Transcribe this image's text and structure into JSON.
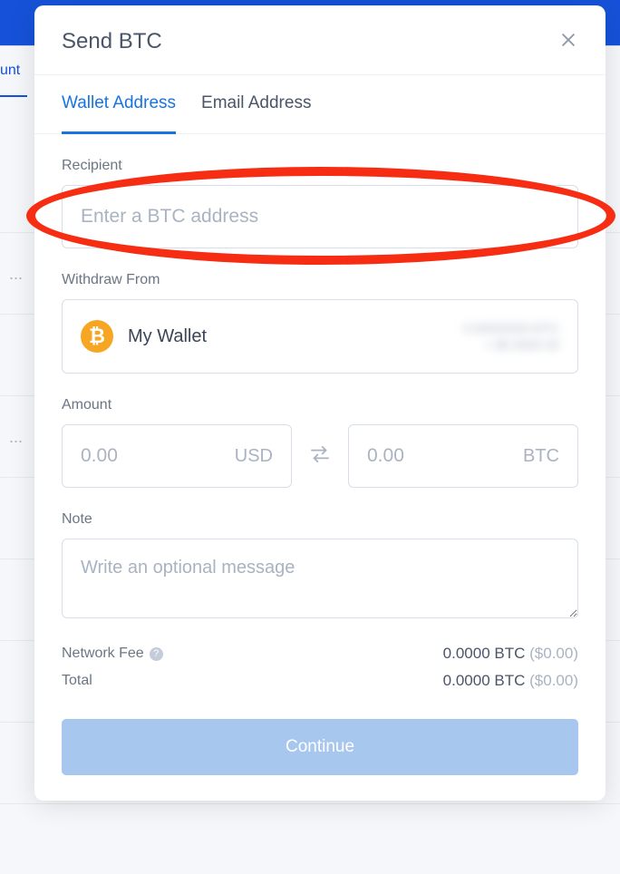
{
  "background": {
    "side_label": "unt",
    "ellipsis": "..."
  },
  "modal": {
    "title": "Send BTC",
    "tabs": {
      "wallet": "Wallet Address",
      "email": "Email Address"
    },
    "recipient": {
      "label": "Recipient",
      "placeholder": "Enter a BTC address"
    },
    "withdraw": {
      "label": "Withdraw From",
      "wallet_name": "My Wallet",
      "balance_primary": "0.00000000 BTC",
      "balance_secondary": "= $0.0000.00"
    },
    "amount": {
      "label": "Amount",
      "usd_placeholder": "0.00",
      "usd_currency": "USD",
      "btc_placeholder": "0.00",
      "btc_currency": "BTC"
    },
    "note": {
      "label": "Note",
      "placeholder": "Write an optional message"
    },
    "fees": {
      "network_label": "Network Fee",
      "network_value": "0.0000 BTC",
      "network_usd": "($0.00)",
      "total_label": "Total",
      "total_value": "0.0000 BTC",
      "total_usd": "($0.00)"
    },
    "continue_label": "Continue"
  }
}
